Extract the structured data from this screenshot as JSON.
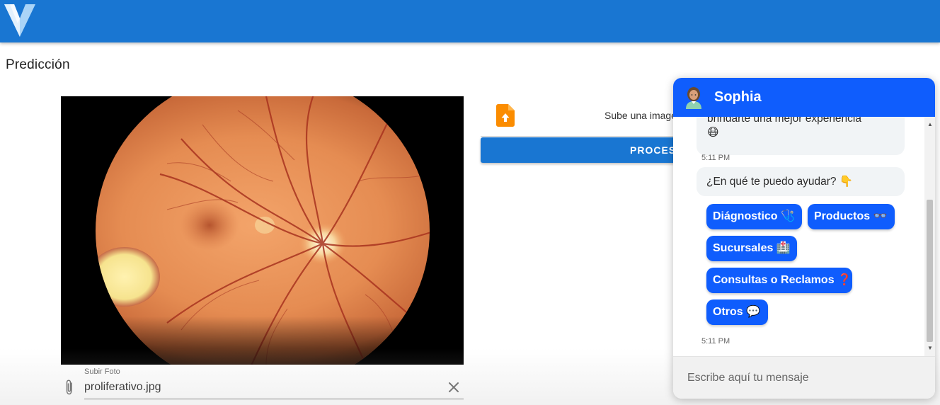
{
  "header": {
    "logo_icon": "v-logo-icon",
    "color": "#1976d2"
  },
  "page": {
    "title": "Predicción"
  },
  "file_input": {
    "label": "Subir Foto",
    "value": "proliferativo.jpg",
    "attach_icon": "paperclip-icon",
    "clear_icon": "close-icon"
  },
  "upload": {
    "icon": "file-upload-icon",
    "text": "Sube una imagen"
  },
  "process_button": {
    "label": "PROCESAR"
  },
  "chat": {
    "agent_name": "Sophia",
    "avatar_icon": "woman-health-worker-icon",
    "accent_color": "#0f5dfd",
    "messages": [
      {
        "text": "brindarte una mejor experiencia",
        "emoji": "😷"
      },
      {
        "text": "¿En qué te puedo ayudar? 👇"
      }
    ],
    "timestamps": [
      "5:11 PM",
      "5:11 PM"
    ],
    "quick_replies": [
      "Diágnostico 🩺",
      "Productos 👓",
      "Sucursales 🏥",
      "Consultas o Reclamos ❓",
      "Otros 💬"
    ],
    "input_placeholder": "Escribe aquí tu mensaje"
  }
}
